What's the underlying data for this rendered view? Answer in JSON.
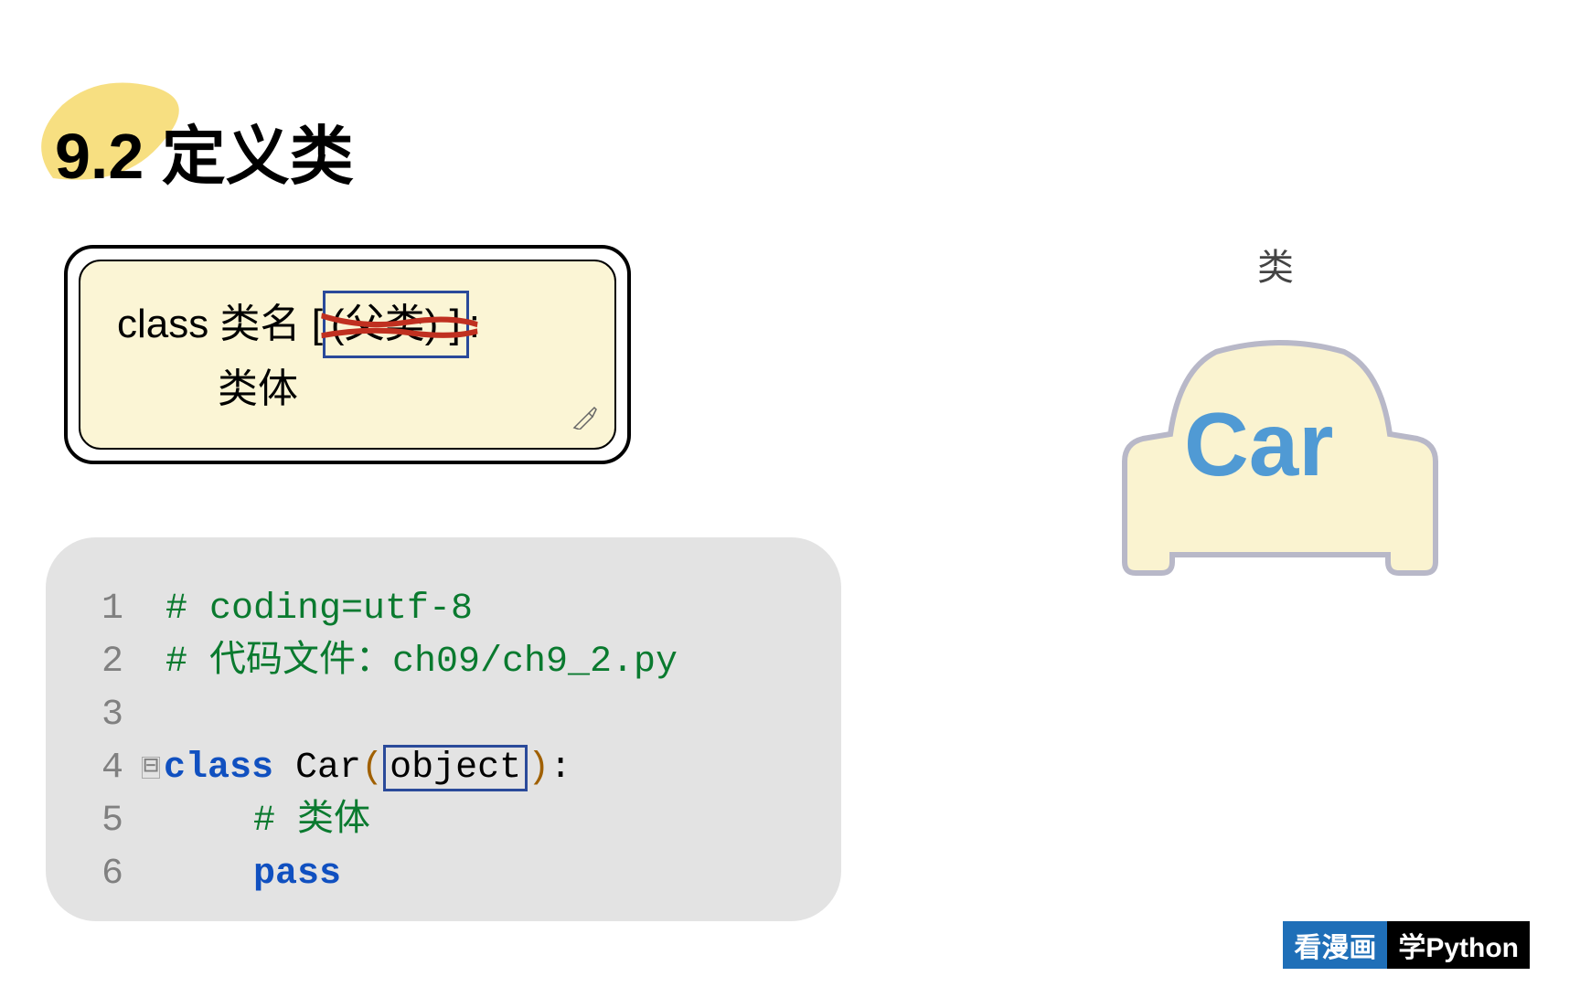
{
  "heading": "9.2 定义类",
  "syntax": {
    "prefix": "class 类名 [",
    "parent": "(父类) ]",
    "colon": ":",
    "body": "类体"
  },
  "code": {
    "lines": [
      {
        "n": "1",
        "html": "<span class='comment'># coding=utf-8</span>"
      },
      {
        "n": "2",
        "html": "<span class='comment'># 代码文件：ch09/ch9_2.py</span>"
      },
      {
        "n": "3",
        "html": ""
      },
      {
        "n": "4",
        "fold": true,
        "html": "<span class='kw'>class</span> <span class='cls'>Car</span><span class='paren'>(</span><span class='obj-box'>object</span><span class='paren'>)</span>:"
      },
      {
        "n": "5",
        "html": "    <span class='comment'># 类体</span>"
      },
      {
        "n": "6",
        "html": "    <span class='kw'>pass</span>"
      }
    ]
  },
  "diagram": {
    "label": "类",
    "car_text": "Car"
  },
  "watermark": {
    "left": "看漫画",
    "right": "学Python"
  }
}
